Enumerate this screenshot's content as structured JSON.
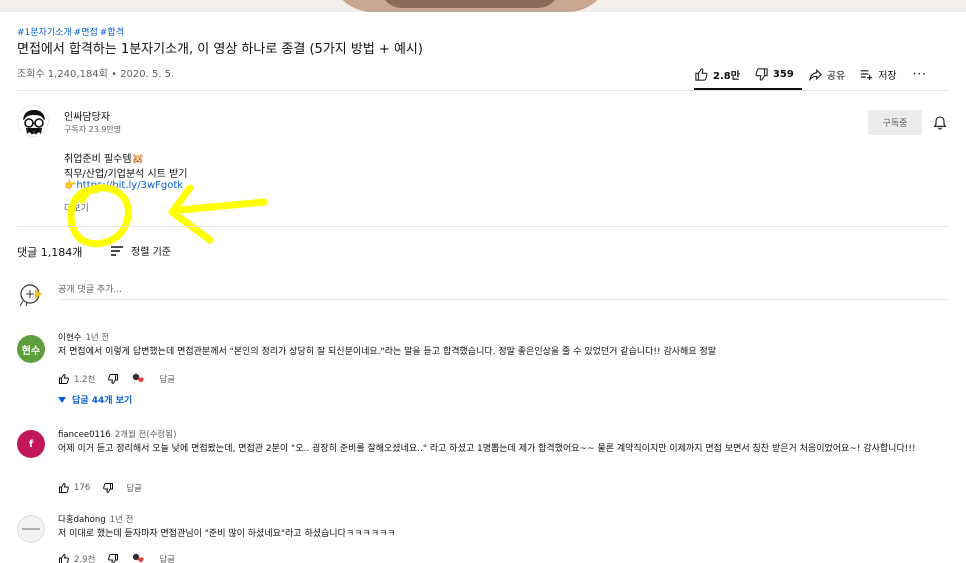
{
  "video": {
    "hashtags": [
      "#1분자기소개",
      "#면접",
      "#합격"
    ],
    "title": "면접에서 합격하는 1분자기소개, 이 영상 하나로 종결 (5가지 방법 + 예시)",
    "views": "조회수 1,240,184회",
    "separator": "•",
    "date": "2020. 5. 5."
  },
  "actions": {
    "like_count": "2.8만",
    "dislike_count": "359",
    "share_label": "공유",
    "save_label": "저장",
    "more_label": "···"
  },
  "channel": {
    "name": "인싸담당자",
    "subscribers": "구독자 23.9만명",
    "subscribe_label": "구독중"
  },
  "description": {
    "line1": "취업준비 필수템🐹",
    "line2": "직무/산업/기업분석 시트 받기",
    "link_prefix": "👉",
    "link": "https://bit.ly/3wFgotk",
    "show_more": "더보기"
  },
  "comments_header": {
    "count": "댓글 1,184개",
    "sort_label": "정렬 기준",
    "add_placeholder": "공개 댓글 추가..."
  },
  "comments": [
    {
      "avatar_text": "현수",
      "avatar_color": "#5c9f3c",
      "author": "이현수",
      "time": "1년 전",
      "text": "저 면접에서 이렇게 답변했는데 면접관분께서 \"본인의 정리가 상당히 잘 되신분이네요.\"라는 말을 듣고 합격했습니다. 정말 좋은인상을 줄 수 있었던거 같습니다!! 감사해요 정말",
      "likes": "1.2천",
      "reply_label": "답글",
      "view_replies": "답글 44개 보기"
    },
    {
      "avatar_text": "f",
      "avatar_color": "#c2185b",
      "author": "fiancee0116",
      "time": "2개월 전(수정됨)",
      "text": "어제 이거 듣고 정리해서 오늘 낮에 면접봤는데, 면접관 2분이 \"오.. 굉장히 준비를 잘해오셨네요..\" 라고 하셨고 1명뽑는데 제가 합격했어요~~ 물론 계약직이지만 이제까지 면접 보면서 칭찬 받은거 처음이었어요~! 감사합니다!!!",
      "likes": "176",
      "reply_label": "답글"
    },
    {
      "avatar_text": "",
      "avatar_color": "#f2f2f2",
      "author": "다홍dahong",
      "time": "1년 전",
      "text": "저 이대로 했는데 듣자마자 면접관님이 \"준비 많이 하셨네요\"라고 하셨습니다ㅋㅋㅋㅋㅋㅋ",
      "likes": "2.9천",
      "reply_label": "답글"
    }
  ],
  "colors": {
    "link": "#065fd4",
    "annotation": "#ffff00",
    "heart": "#e53935"
  }
}
